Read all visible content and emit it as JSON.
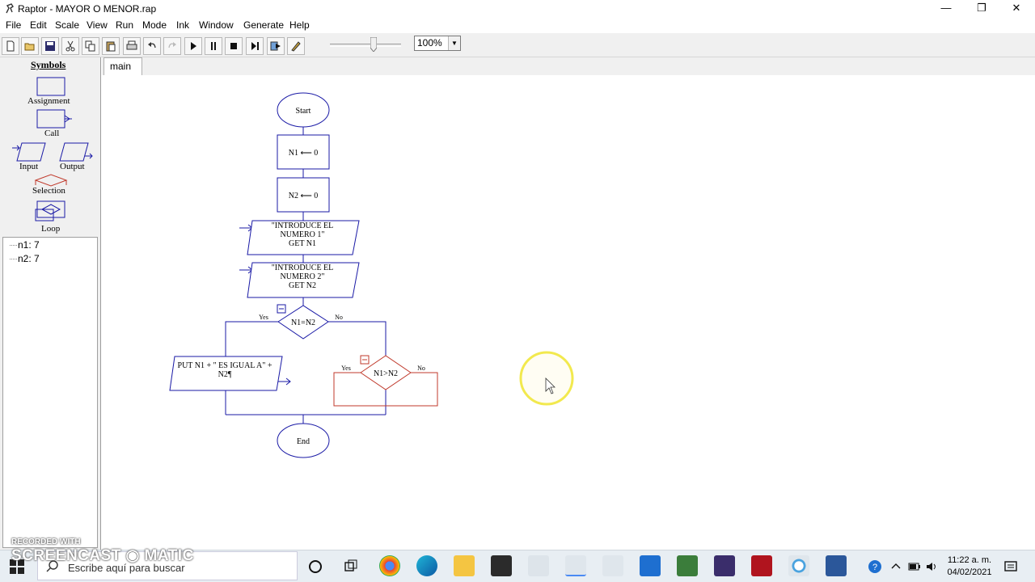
{
  "window": {
    "title": "Raptor - MAYOR O MENOR.rap",
    "minimize": "—",
    "restore": "❐",
    "close": "✕"
  },
  "menu": [
    "File",
    "Edit",
    "Scale",
    "View",
    "Run",
    "Mode",
    "Ink",
    "Window",
    "Generate",
    "Help"
  ],
  "toolbar": {
    "zoom": "100%",
    "buttons": [
      "new-icon",
      "open-icon",
      "save-icon",
      "cut-icon",
      "copy-icon",
      "paste-icon",
      "print-icon",
      "undo-icon",
      "redo-icon",
      "execute-icon",
      "pause-icon",
      "stop-icon",
      "step-icon",
      "step-to-completion-icon",
      "pen-icon"
    ]
  },
  "symbols": {
    "title": "Symbols",
    "assignment": "Assignment",
    "call": "Call",
    "input": "Input",
    "output": "Output",
    "selection": "Selection",
    "loop": "Loop"
  },
  "variables": [
    "n1: 7",
    "n2: 7"
  ],
  "tabs": [
    "main"
  ],
  "flowchart": {
    "start": "Start",
    "assign1": "N1 ⟵ 0",
    "assign2": "N2 ⟵ 0",
    "input1": [
      "\"INTRODUCE EL",
      "NUMERO 1\"",
      "GET N1"
    ],
    "input2": [
      "\"INTRODUCE EL",
      "NUMERO 2\"",
      "GET N2"
    ],
    "decision1": "N1=N2",
    "yes1": "Yes",
    "no1": "No",
    "output1": [
      "PUT N1 + \" ES IGUAL A\" +",
      "N2¶"
    ],
    "decision2": "N1>N2",
    "yes2": "Yes",
    "no2": "No",
    "end": "End"
  },
  "watermark": {
    "line1": "RECORDED WITH",
    "line2": "SCREENCAST",
    "line3": "MATIC"
  },
  "taskbar": {
    "search_placeholder": "Escribe aquí para buscar",
    "time": "11:22 a. m.",
    "date": "04/02/2021"
  },
  "colors": {
    "flow_blue": "#1a1aa6",
    "selection_red": "#c0392b",
    "cursor_highlight": "#f2e94e"
  }
}
